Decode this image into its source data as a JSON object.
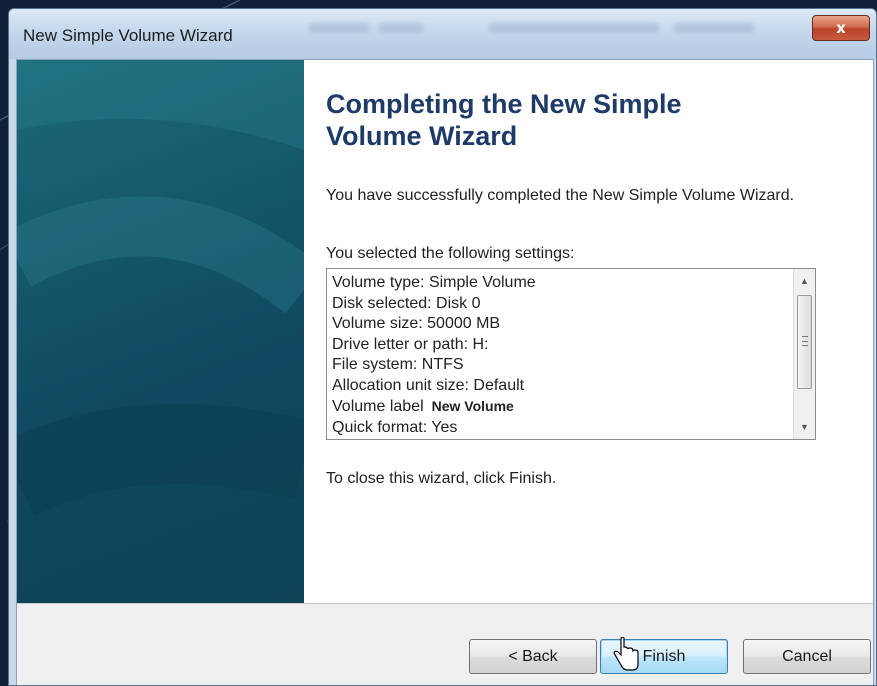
{
  "window": {
    "title": "New Simple Volume Wizard",
    "close_glyph": "x"
  },
  "content": {
    "heading": "Completing the New Simple Volume Wizard",
    "intro": "You have successfully completed the New Simple Volume Wizard.",
    "settings_caption": "You selected the following settings:",
    "settings": [
      "Volume type: Simple Volume",
      "Disk selected: Disk 0",
      "Volume size: 50000 MB",
      "Drive letter or path: H:",
      "File system: NTFS",
      "Allocation unit size: Default",
      "Volume label",
      "Quick format: Yes"
    ],
    "volume_label_value": "New Volume",
    "close_note": "To close this wizard, click Finish."
  },
  "buttons": {
    "back": "< Back",
    "finish": "Finish",
    "cancel": "Cancel"
  },
  "scrollbar": {
    "up_glyph": "▲",
    "down_glyph": "▼"
  },
  "icons": [
    "close-icon",
    "scroll-up-arrow-icon",
    "scroll-down-arrow-icon",
    "scroll-grip-icon",
    "hand-cursor-icon"
  ],
  "colors": {
    "heading": "#1e3a66",
    "banner": "#14566a",
    "titlebar": "#c4d7ec",
    "close_button": "#c75a3f",
    "finish_button": "#bee6fd"
  }
}
